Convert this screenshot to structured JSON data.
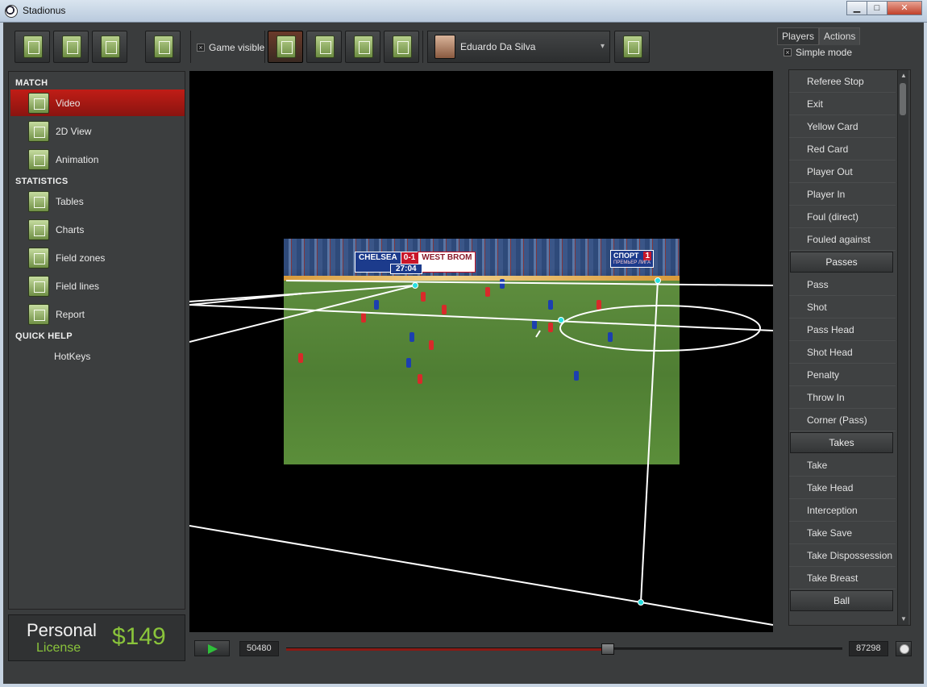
{
  "window": {
    "title": "Stadionus",
    "min": "▁",
    "max": "□",
    "close": "✕"
  },
  "toolbar": {
    "game_visible_label": "Game visible",
    "game_visible_mark": "×",
    "player_name": "Eduardo Da Silva",
    "player_dropdown_arrow": "▾"
  },
  "nav": {
    "match_title": "MATCH",
    "statistics_title": "STATISTICS",
    "quickhelp_title": "QUICK HELP",
    "items": [
      {
        "label": "Video",
        "icon": "video-icon"
      },
      {
        "label": "2D View",
        "icon": "field-2d-icon"
      },
      {
        "label": "Animation",
        "icon": "animation-icon"
      },
      {
        "label": "Tables",
        "icon": "table-icon"
      },
      {
        "label": "Charts",
        "icon": "chart-icon"
      },
      {
        "label": "Field zones",
        "icon": "field-zones-icon"
      },
      {
        "label": "Field lines",
        "icon": "field-lines-icon"
      },
      {
        "label": "Report",
        "icon": "report-icon"
      },
      {
        "label": "HotKeys",
        "icon": ""
      }
    ]
  },
  "license": {
    "personal": "Personal",
    "license": "License",
    "price": "$149"
  },
  "video": {
    "home_team": "CHELSEA",
    "score": "0-1",
    "away_team": "WEST BROM",
    "match_clock": "27:04",
    "channel_name": "СПОРТ",
    "channel_number": "1",
    "channel_sub": "ПРЕМЬЕР ЛИГА"
  },
  "right": {
    "tabs": [
      "Players",
      "Actions"
    ],
    "simple_mode_label": "Simple mode",
    "simple_mode_mark": "×",
    "actions": [
      {
        "type": "item",
        "label": "Referee Stop"
      },
      {
        "type": "item",
        "label": "Exit"
      },
      {
        "type": "item",
        "label": "Yellow Card"
      },
      {
        "type": "item",
        "label": "Red Card"
      },
      {
        "type": "item",
        "label": "Player Out"
      },
      {
        "type": "item",
        "label": "Player In"
      },
      {
        "type": "item",
        "label": "Foul (direct)"
      },
      {
        "type": "item",
        "label": "Fouled against"
      },
      {
        "type": "group",
        "label": "Passes"
      },
      {
        "type": "item",
        "label": "Pass"
      },
      {
        "type": "item",
        "label": "Shot"
      },
      {
        "type": "item",
        "label": "Pass Head"
      },
      {
        "type": "item",
        "label": "Shot Head"
      },
      {
        "type": "item",
        "label": "Penalty"
      },
      {
        "type": "item",
        "label": "Throw In"
      },
      {
        "type": "item",
        "label": "Corner (Pass)"
      },
      {
        "type": "group",
        "label": "Takes"
      },
      {
        "type": "item",
        "label": "Take"
      },
      {
        "type": "item",
        "label": "Take Head"
      },
      {
        "type": "item",
        "label": "Interception"
      },
      {
        "type": "item",
        "label": "Take Save"
      },
      {
        "type": "item",
        "label": "Take Dispossession"
      },
      {
        "type": "item",
        "label": "Take Breast"
      },
      {
        "type": "group",
        "label": "Ball"
      }
    ]
  },
  "transport": {
    "current_frame": "50480",
    "total_frames": "87298",
    "progress": 0.578
  }
}
